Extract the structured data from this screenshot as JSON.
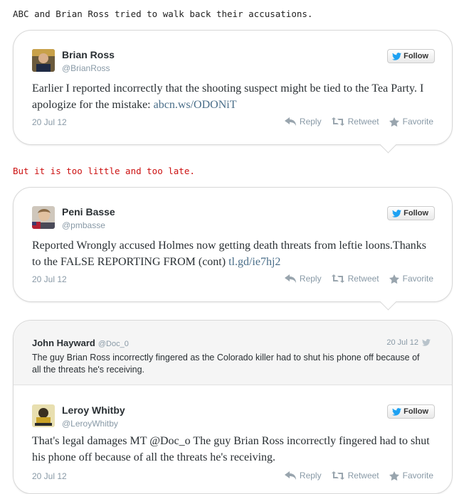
{
  "captions": {
    "first": "ABC and Brian Ross tried to walk back their accusations.",
    "second": "But it is too little and too late."
  },
  "colors": {
    "caption_red": "#cc1111",
    "twitter_blue": "#1da1f2",
    "link": "#4a6e89"
  },
  "tweets": [
    {
      "name": "Brian Ross",
      "handle": "@BrianRoss",
      "follow_label": "Follow",
      "text": "Earlier I reported incorrectly that the shooting suspect might be tied to the Tea Party. I apologize for the mistake: ",
      "link": "abcn.ws/ODONiT",
      "date": "20 Jul 12",
      "reply": "Reply",
      "retweet": "Retweet",
      "favorite": "Favorite"
    },
    {
      "name": "Peni Basse",
      "handle": "@pmbasse",
      "follow_label": "Follow",
      "text": "Reported Wrongly accused Holmes now getting death threats from leftie loons.Thanks to the FALSE REPORTING FROM (cont) ",
      "link": "tl.gd/ie7hj2",
      "date": "20 Jul 12",
      "reply": "Reply",
      "retweet": "Retweet",
      "favorite": "Favorite"
    },
    {
      "name": "Leroy Whitby",
      "handle": "@LeroyWhitby",
      "follow_label": "Follow",
      "text": "That's legal damages MT @Doc_o The guy Brian Ross incorrectly fingered had to shut his phone off because of all the threats he's receiving.",
      "link": "",
      "date": "20 Jul 12",
      "reply": "Reply",
      "retweet": "Retweet",
      "favorite": "Favorite",
      "quoted": {
        "name": "John Hayward",
        "handle": "@Doc_0",
        "date": "20 Jul 12",
        "text": "The guy Brian Ross incorrectly fingered as the Colorado killer had to shut his phone off because of all the threats he's receiving."
      }
    }
  ]
}
